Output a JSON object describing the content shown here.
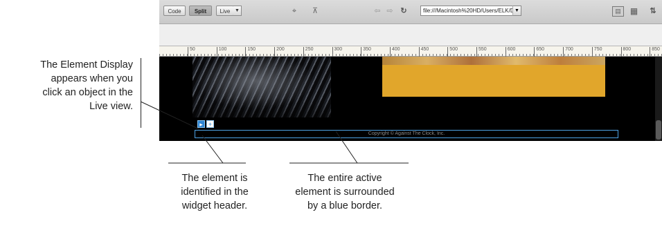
{
  "toolbar": {
    "view_buttons": [
      {
        "label": "Code",
        "active": false
      },
      {
        "label": "Split",
        "active": true
      },
      {
        "label": "Live",
        "active": false
      }
    ],
    "live_dropdown_caret": "▼",
    "icons": [
      "target-icon",
      "inspect-icon",
      "back-icon",
      "forward-icon",
      "refresh-icon",
      "multiscreen-icon",
      "visual-aids-icon",
      "page-options-icon"
    ],
    "address": "file:///Macintosh%20HD/Users/ELK/Deskto...",
    "address_caret": "▼"
  },
  "ruler": {
    "labels": [
      "50",
      "100",
      "150",
      "200",
      "250",
      "300",
      "350",
      "400",
      "450",
      "500",
      "550",
      "600",
      "650",
      "700",
      "750",
      "800",
      "850"
    ]
  },
  "live_view": {
    "footer_text": "Copyright © Against The Clock, Inc.",
    "element_border_color": "#4ea3e6",
    "widget_tag_symbol": "▸",
    "widget_add_symbol": "+",
    "yellow_block_color": "#e1a62b"
  },
  "callouts": {
    "left": [
      "The Element Display",
      "appears when you",
      "click an object in the",
      "Live view."
    ],
    "middle": [
      "The element is",
      "identified in the",
      "widget header."
    ],
    "right": [
      "The entire active",
      "element is surrounded",
      "by a blue border."
    ]
  }
}
